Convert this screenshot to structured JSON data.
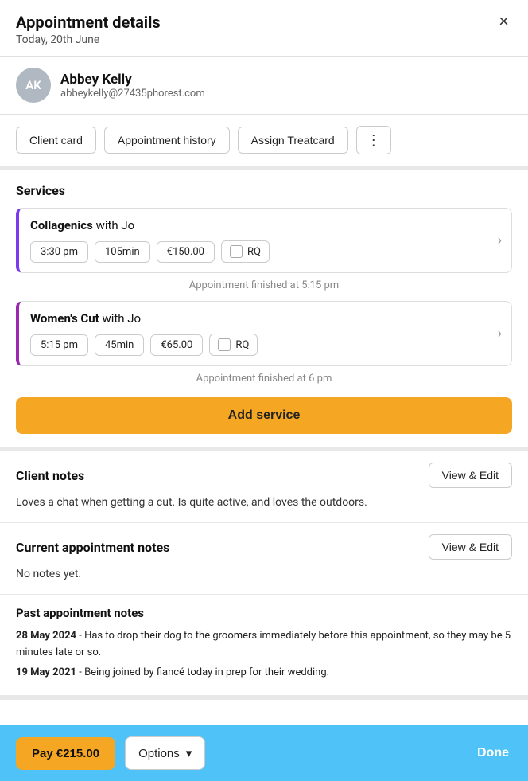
{
  "header": {
    "title": "Appointment details",
    "date": "Today, 20th June",
    "close_label": "×"
  },
  "client": {
    "initials": "AK",
    "name": "Abbey Kelly",
    "email": "abbeykelly@27435phorest.com"
  },
  "action_buttons": {
    "client_card": "Client card",
    "appointment_history": "Appointment history",
    "assign_treatcard": "Assign Treatcard",
    "more": "⋮"
  },
  "services": {
    "section_title": "Services",
    "items": [
      {
        "name": "Collagenics",
        "provider": "with Jo",
        "time": "3:30 pm",
        "duration": "105min",
        "price": "€150.00",
        "rq_label": "RQ",
        "finished_text": "Appointment finished at 5:15 pm",
        "border_color": "#7c3aed"
      },
      {
        "name": "Women's Cut",
        "provider": "with Jo",
        "time": "5:15 pm",
        "duration": "45min",
        "price": "€65.00",
        "rq_label": "RQ",
        "finished_text": "Appointment finished at 6 pm",
        "border_color": "#9c27b0"
      }
    ],
    "add_service_label": "Add service"
  },
  "client_notes": {
    "title": "Client notes",
    "view_edit_label": "View & Edit",
    "text": "Loves a chat when getting a cut. Is quite active, and loves the outdoors."
  },
  "current_appointment_notes": {
    "title": "Current appointment notes",
    "view_edit_label": "View & Edit",
    "text": "No notes yet."
  },
  "past_appointment_notes": {
    "title": "Past appointment notes",
    "items": [
      {
        "date": "28 May 2024",
        "text": "- Has to drop their dog to the groomers immediately before this appointment, so they may be 5 minutes late or so."
      },
      {
        "date": "19 May 2021",
        "text": "- Being joined by fiancé today in prep for their wedding."
      }
    ]
  },
  "footer": {
    "pay_label": "Pay €215.00",
    "options_label": "Options",
    "chevron_down": "▾",
    "done_label": "Done"
  }
}
